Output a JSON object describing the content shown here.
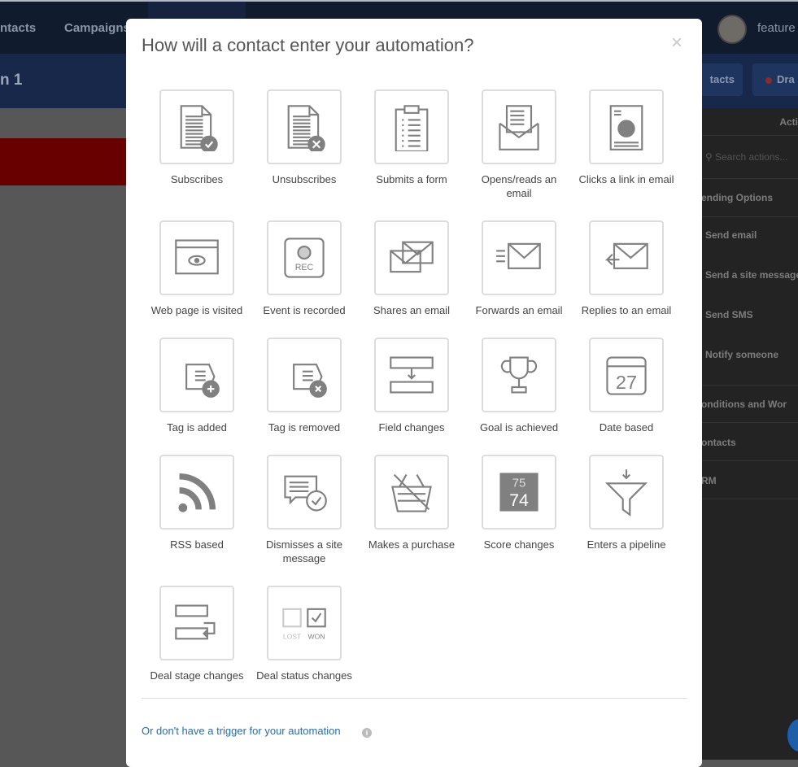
{
  "topnav": {
    "items": [
      "ntacts",
      "Campaigns"
    ],
    "user": "feature"
  },
  "subbar": {
    "title": "n 1",
    "contacts_btn": "tacts",
    "draft_btn": "Dra"
  },
  "actions_panel": {
    "header": "Acti",
    "search_placeholder": "Search actions...",
    "sections": [
      "ending Options",
      "Send email",
      "Send a site message",
      "Send SMS",
      "Notify someone",
      "onditions and Wor",
      "ontacts",
      "RM"
    ]
  },
  "modal": {
    "title": "How will a contact enter your automation?",
    "close": "×",
    "triggers": [
      {
        "label": "Subscribes",
        "icon": "doc-check-icon"
      },
      {
        "label": "Unsubscribes",
        "icon": "doc-x-icon"
      },
      {
        "label": "Submits a form",
        "icon": "clipboard-icon"
      },
      {
        "label": "Opens/reads an email",
        "icon": "open-envelope-icon"
      },
      {
        "label": "Clicks a link in email",
        "icon": "link-doc-icon"
      },
      {
        "label": "Web page is visited",
        "icon": "browser-eye-icon"
      },
      {
        "label": "Event is recorded",
        "icon": "rec-icon"
      },
      {
        "label": "Shares an email",
        "icon": "share-envelope-icon"
      },
      {
        "label": "Forwards an email",
        "icon": "forward-envelope-icon"
      },
      {
        "label": "Replies to an email",
        "icon": "reply-envelope-icon"
      },
      {
        "label": "Tag is added",
        "icon": "tag-plus-icon"
      },
      {
        "label": "Tag is removed",
        "icon": "tag-x-icon"
      },
      {
        "label": "Field changes",
        "icon": "field-icon"
      },
      {
        "label": "Goal is achieved",
        "icon": "trophy-icon"
      },
      {
        "label": "Date based",
        "icon": "calendar-icon"
      },
      {
        "label": "RSS based",
        "icon": "rss-icon"
      },
      {
        "label": "Dismisses a site message",
        "icon": "message-check-icon"
      },
      {
        "label": "Makes a purchase",
        "icon": "basket-icon"
      },
      {
        "label": "Score changes",
        "icon": "score-icon"
      },
      {
        "label": "Enters a pipeline",
        "icon": "funnel-icon"
      },
      {
        "label": "Deal stage changes",
        "icon": "deal-stage-icon"
      },
      {
        "label": "Deal status changes",
        "icon": "deal-status-icon"
      }
    ],
    "calendar_day": "27",
    "rec": "REC",
    "score_top": "75",
    "score_bottom": "74",
    "lost": "LOST",
    "won": "WON",
    "no_trigger_link": "Or don't have a trigger for your automation",
    "info": "i"
  }
}
